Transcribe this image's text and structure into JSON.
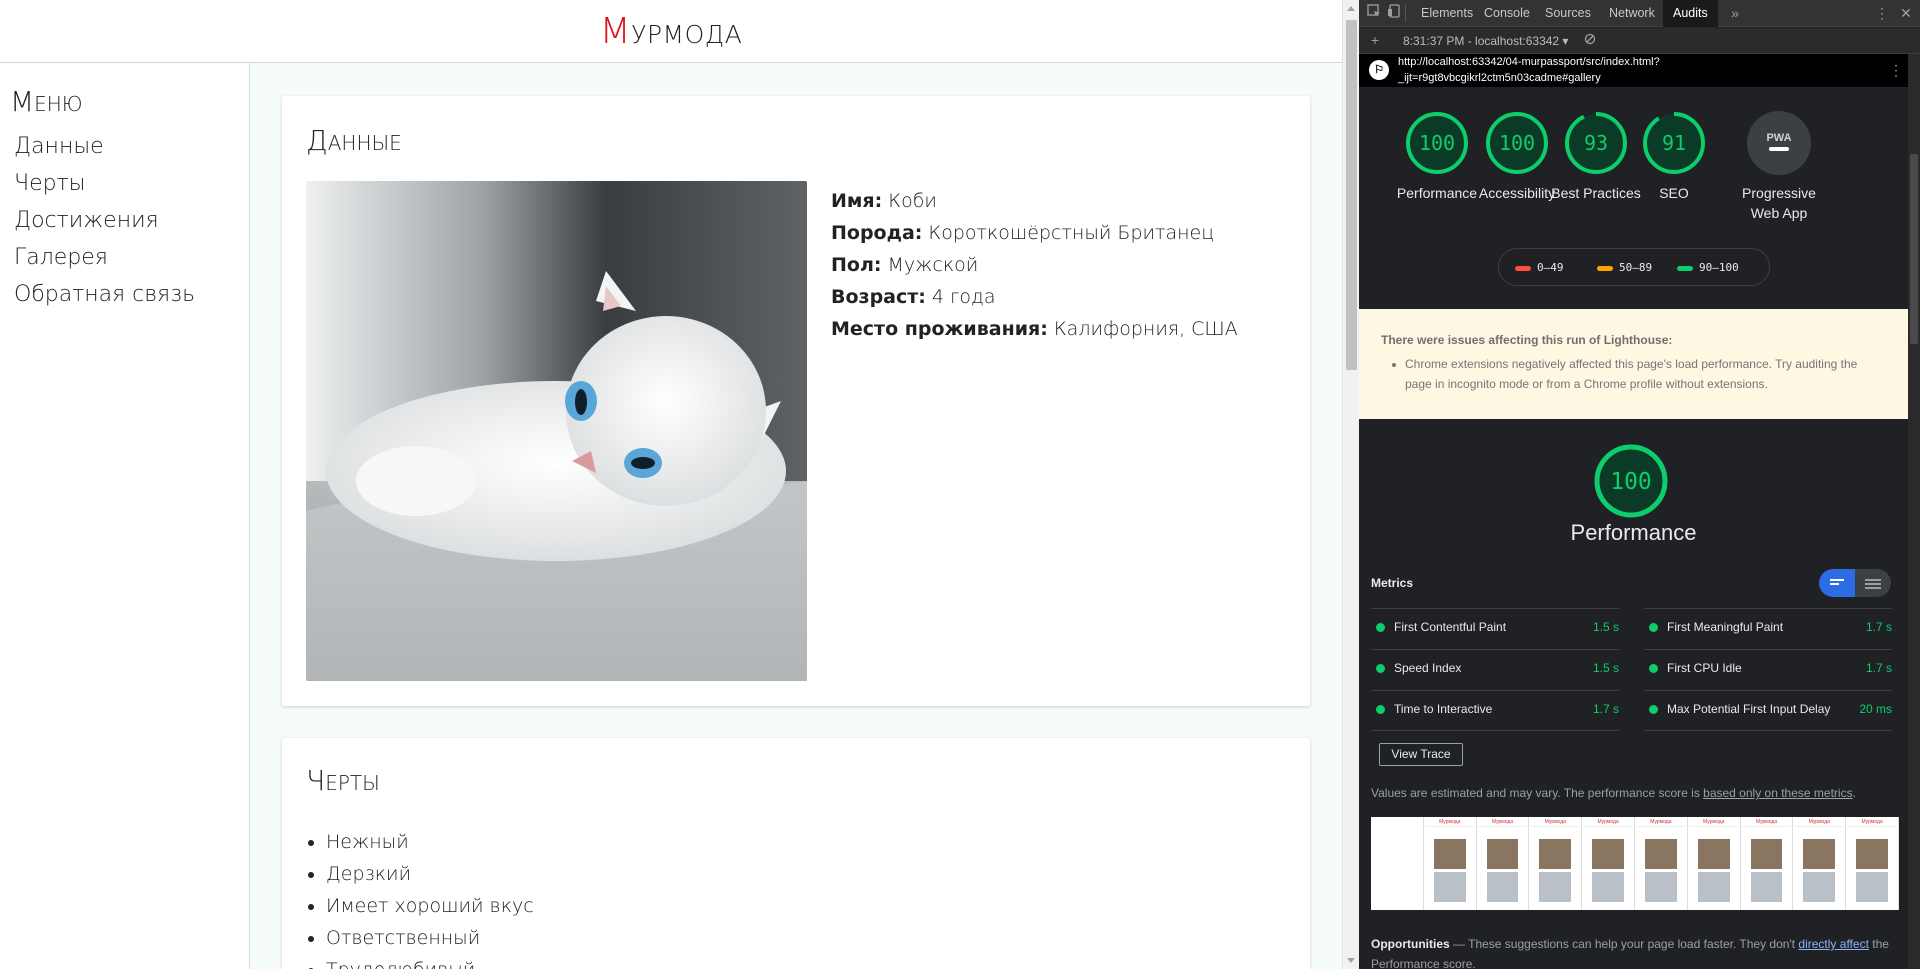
{
  "site": {
    "title_first": "М",
    "title_rest": "урмода",
    "menu_title": "Меню",
    "menu_items": [
      "Данные",
      "Черты",
      "Достижения",
      "Галерея",
      "Обратная связь"
    ]
  },
  "data_card": {
    "title": "Данные",
    "fields": [
      {
        "label": "Имя:",
        "value": "Коби"
      },
      {
        "label": "Порода:",
        "value": "Короткошёрстный Британец"
      },
      {
        "label": "Пол:",
        "value": "Мужской"
      },
      {
        "label": "Возраст:",
        "value": "4 года"
      },
      {
        "label": "Место проживания:",
        "value": "Калифорния, США"
      }
    ]
  },
  "traits_card": {
    "title": "Черты",
    "items": [
      "Нежный",
      "Дерзкий",
      "Имеет хороший вкус",
      "Ответственный",
      "Трудолюбивый"
    ]
  },
  "devtools": {
    "tabs": [
      "Elements",
      "Console",
      "Sources",
      "Network",
      "Audits"
    ],
    "active_tab": "Audits",
    "run_label": "8:31:37 PM - localhost:63342 ▾",
    "url_line1": "http://localhost:63342/04-murpassport/src/index.html?",
    "url_line2": "_ijt=r9gt8vbcgikrl2ctm5n03cadme#gallery",
    "colors": {
      "pass": "#0cce6b",
      "average": "#ffa400",
      "fail": "#ff4e42",
      "toggle": "#2d6be4"
    },
    "gauges": [
      {
        "label": "Performance",
        "score": "100",
        "fraction": 1.0
      },
      {
        "label": "Accessibility",
        "score": "100",
        "fraction": 1.0
      },
      {
        "label": "Best Practices",
        "score": "93",
        "fraction": 0.93
      },
      {
        "label": "SEO",
        "score": "91",
        "fraction": 0.91
      },
      {
        "label": "Progressive Web App",
        "score": "PWA",
        "fraction": 0
      }
    ],
    "legend": [
      "0–49",
      "50–89",
      "90–100"
    ],
    "warning_title": "There were issues affecting this run of Lighthouse:",
    "warning_text": "Chrome extensions negatively affected this page's load performance. Try auditing the page in incognito mode or from a Chrome profile without extensions.",
    "perf_score": "100",
    "perf_title": "Performance",
    "metrics_heading": "Metrics",
    "metrics": [
      {
        "name": "First Contentful Paint",
        "value": "1.5 s"
      },
      {
        "name": "First Meaningful Paint",
        "value": "1.7 s"
      },
      {
        "name": "Speed Index",
        "value": "1.5 s"
      },
      {
        "name": "First CPU Idle",
        "value": "1.7 s"
      },
      {
        "name": "Time to Interactive",
        "value": "1.7 s"
      },
      {
        "name": "Max Potential First Input Delay",
        "value": "20 ms"
      }
    ],
    "view_trace": "View Trace",
    "estimate_text": "Values are estimated and may vary. The performance score is ",
    "estimate_link": "based only on these metrics",
    "estimate_end": ".",
    "filmstrip_frame_title": "Мурмода",
    "filmstrip_frame_label": "Галерея",
    "opps_title": "Opportunities",
    "opps_text": " — These suggestions can help your page load faster. They don't ",
    "opps_link": "directly affect",
    "opps_end": " the Performance score."
  }
}
